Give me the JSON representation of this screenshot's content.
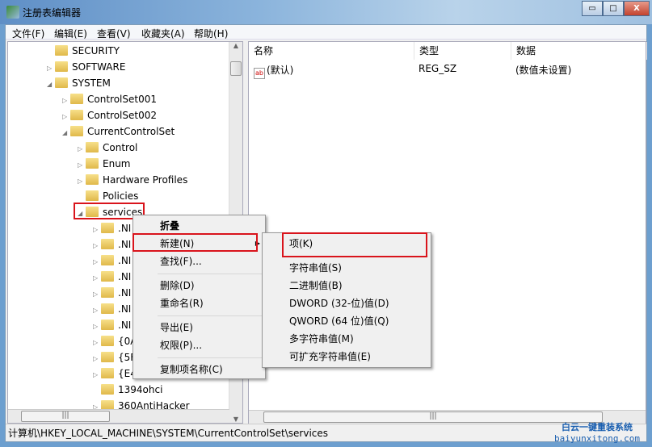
{
  "window": {
    "title": "注册表编辑器",
    "minimize": "▭",
    "maximize": "□",
    "close": "X"
  },
  "menubar": [
    "文件(F)",
    "编辑(E)",
    "查看(V)",
    "收藏夹(A)",
    "帮助(H)"
  ],
  "tree": [
    {
      "label": "SECURITY",
      "level": 0,
      "exp": ""
    },
    {
      "label": "SOFTWARE",
      "level": 0,
      "exp": "▷"
    },
    {
      "label": "SYSTEM",
      "level": 0,
      "exp": "◢"
    },
    {
      "label": "ControlSet001",
      "level": 1,
      "exp": "▷"
    },
    {
      "label": "ControlSet002",
      "level": 1,
      "exp": "▷"
    },
    {
      "label": "CurrentControlSet",
      "level": 1,
      "exp": "◢"
    },
    {
      "label": "Control",
      "level": 2,
      "exp": "▷"
    },
    {
      "label": "Enum",
      "level": 2,
      "exp": "▷"
    },
    {
      "label": "Hardware Profiles",
      "level": 2,
      "exp": "▷"
    },
    {
      "label": "Policies",
      "level": 2,
      "exp": ""
    },
    {
      "label": "services",
      "level": 2,
      "exp": "◢"
    },
    {
      "label": ".NI",
      "level": 3,
      "exp": "▷"
    },
    {
      "label": ".NI",
      "level": 3,
      "exp": "▷"
    },
    {
      "label": ".NI",
      "level": 3,
      "exp": "▷"
    },
    {
      "label": ".NI",
      "level": 3,
      "exp": "▷"
    },
    {
      "label": ".NI",
      "level": 3,
      "exp": "▷"
    },
    {
      "label": ".NI",
      "level": 3,
      "exp": "▷"
    },
    {
      "label": ".NI",
      "level": 3,
      "exp": "▷"
    },
    {
      "label": "{0A",
      "level": 3,
      "exp": "▷"
    },
    {
      "label": "{5F",
      "level": 3,
      "exp": "▷"
    },
    {
      "label": "{E4",
      "level": 3,
      "exp": "▷"
    },
    {
      "label": "1394ohci",
      "level": 3,
      "exp": ""
    },
    {
      "label": "360AntiHacker",
      "level": 3,
      "exp": "▷"
    }
  ],
  "list": {
    "headers": [
      "名称",
      "类型",
      "数据"
    ],
    "rows": [
      {
        "name": "(默认)",
        "type": "REG_SZ",
        "data": "(数值未设置)",
        "icon": "ab"
      }
    ]
  },
  "context_menu": [
    "折叠",
    "新建(N)",
    "查找(F)...",
    "删除(D)",
    "重命名(R)",
    "导出(E)",
    "权限(P)...",
    "复制项名称(C)"
  ],
  "submenu": [
    "项(K)",
    "字符串值(S)",
    "二进制值(B)",
    "DWORD (32-位)值(D)",
    "QWORD (64 位)值(Q)",
    "多字符串值(M)",
    "可扩充字符串值(E)"
  ],
  "status": "计算机\\HKEY_LOCAL_MACHINE\\SYSTEM\\CurrentControlSet\\services",
  "watermark": {
    "line1": "白云一键重装系统",
    "line2": "baiyunxitong.com"
  },
  "colors": {
    "highlight": "#d9141c"
  }
}
